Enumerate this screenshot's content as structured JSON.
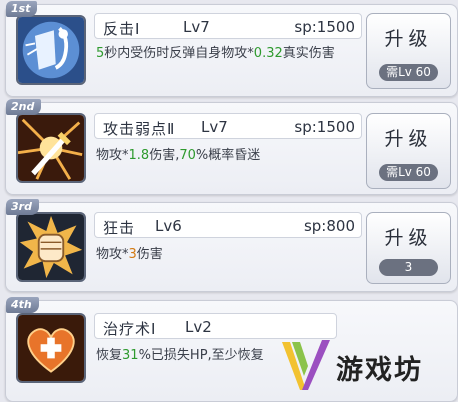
{
  "skills": [
    {
      "rank": "1st",
      "name": "反击Ⅰ",
      "level": "Lv7",
      "sp": "sp:1500",
      "desc_parts": [
        {
          "t": "5",
          "c": "green"
        },
        {
          "t": "秒内受伤时反弹自身物攻*",
          "c": ""
        },
        {
          "t": "0.32",
          "c": "green"
        },
        {
          "t": "真实伤害",
          "c": ""
        }
      ],
      "upgrade_label": "升级",
      "requirement": "需Lv 60",
      "icon": "shield-reflect-icon"
    },
    {
      "rank": "2nd",
      "name": "攻击弱点Ⅱ",
      "level": "Lv7",
      "sp": "sp:1500",
      "desc_parts": [
        {
          "t": "物攻*",
          "c": ""
        },
        {
          "t": "1.8",
          "c": "green"
        },
        {
          "t": "伤害,",
          "c": ""
        },
        {
          "t": "70",
          "c": "green"
        },
        {
          "t": "%概率昏迷",
          "c": ""
        }
      ],
      "upgrade_label": "升级",
      "requirement": "需Lv 60",
      "icon": "sword-burst-icon"
    },
    {
      "rank": "3rd",
      "name": "狂击",
      "level": "Lv6",
      "sp": "sp:800",
      "desc_parts": [
        {
          "t": "物攻*",
          "c": ""
        },
        {
          "t": "3",
          "c": "orange"
        },
        {
          "t": "伤害",
          "c": ""
        }
      ],
      "upgrade_label": "升级",
      "requirement": "3",
      "icon": "fist-burst-icon"
    },
    {
      "rank": "4th",
      "name": "治疗术Ⅰ",
      "level": "Lv2",
      "sp": "",
      "desc_parts": [
        {
          "t": "恢复",
          "c": ""
        },
        {
          "t": "31",
          "c": "green"
        },
        {
          "t": "%已损失HP,至少恢复",
          "c": ""
        }
      ],
      "upgrade_label": "",
      "requirement": "",
      "icon": "heart-heal-icon"
    }
  ],
  "watermark": {
    "text": "游戏坊",
    "icon": "v-logo-icon"
  },
  "colors": {
    "green": "#2e9a2e",
    "orange": "#d37a12",
    "rank_badge": "#7d88a1"
  }
}
